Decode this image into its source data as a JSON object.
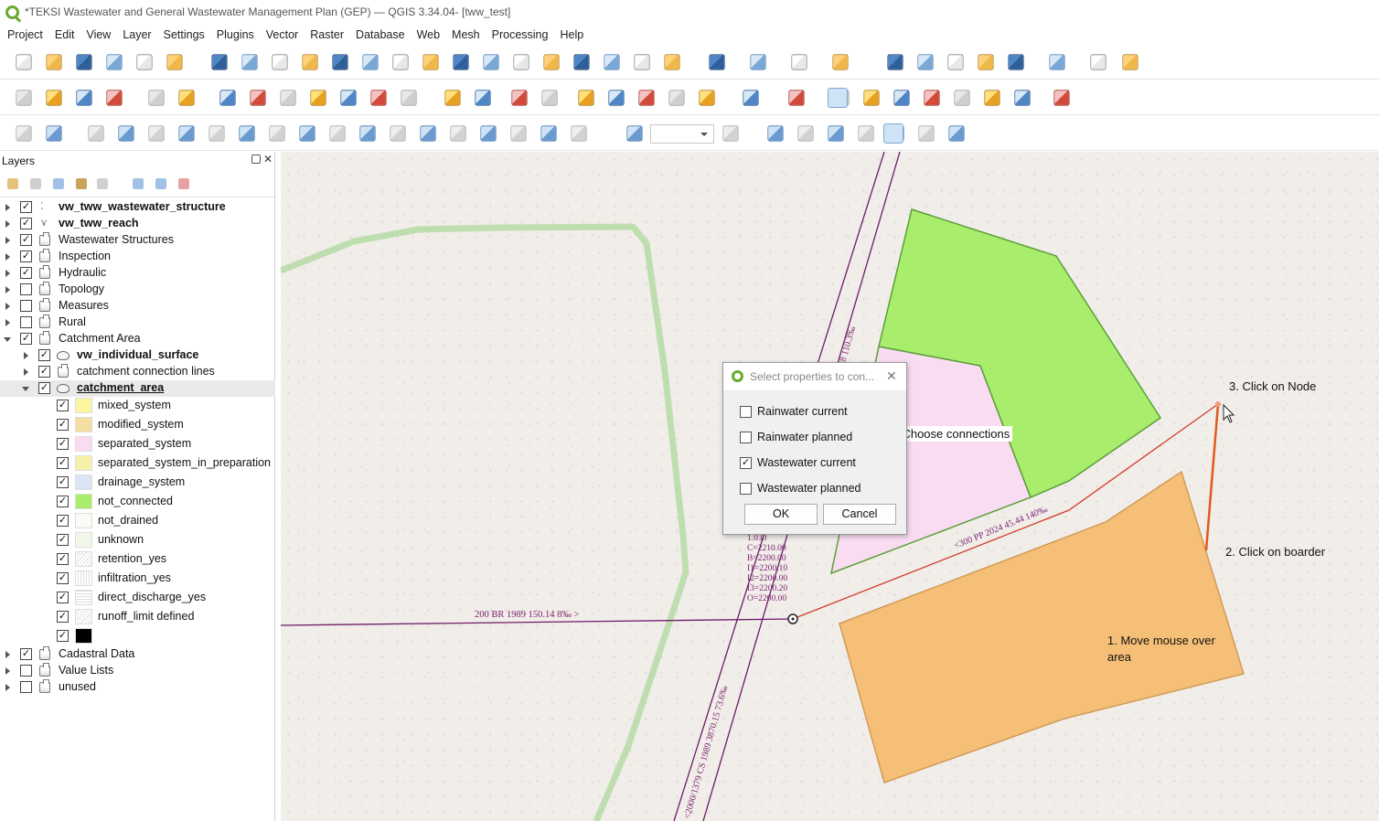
{
  "window": {
    "title": "*TEKSI Wastewater and General Wastewater Management Plan (GEP) — QGIS 3.34.04- [tww_test]"
  },
  "menu": [
    "Project",
    "Edit",
    "View",
    "Layer",
    "Settings",
    "Plugins",
    "Vector",
    "Raster",
    "Database",
    "Web",
    "Mesh",
    "Processing",
    "Help"
  ],
  "layers_panel": {
    "title": "Layers",
    "items": [
      {
        "label": "vw_tww_wastewater_structure",
        "checked": true,
        "bold": true,
        "icon": "point-layer-icon"
      },
      {
        "label": "vw_tww_reach",
        "checked": true,
        "bold": true,
        "icon": "line-layer-icon"
      },
      {
        "label": "Wastewater Structures",
        "checked": true,
        "icon": "group-icon"
      },
      {
        "label": "Inspection",
        "checked": true,
        "icon": "group-icon"
      },
      {
        "label": "Hydraulic",
        "checked": true,
        "icon": "group-icon"
      },
      {
        "label": "Topology",
        "checked": false,
        "icon": "group-icon"
      },
      {
        "label": "Measures",
        "checked": false,
        "icon": "group-icon"
      },
      {
        "label": "Rural",
        "checked": false,
        "icon": "group-icon"
      },
      {
        "label": "Catchment Area",
        "checked": true,
        "icon": "group-icon"
      },
      {
        "label": "vw_individual_surface",
        "checked": true,
        "bold": true,
        "icon": "polygon-layer-icon"
      },
      {
        "label": "catchment connection lines",
        "checked": true,
        "icon": "group-icon"
      },
      {
        "label": "catchment_area",
        "checked": true,
        "bold": true,
        "icon": "polygon-layer-icon"
      },
      {
        "label": "mixed_system",
        "checked": true,
        "color": "#fdf6a0"
      },
      {
        "label": "modified_system",
        "checked": true,
        "color": "#f6dda0"
      },
      {
        "label": "separated_system",
        "checked": true,
        "color": "#f9dcf2"
      },
      {
        "label": "separated_system_in_preparation",
        "checked": true,
        "color": "#f7f0a8"
      },
      {
        "label": "drainage_system",
        "checked": true,
        "color": "#dbe5f6"
      },
      {
        "label": "not_connected",
        "checked": true,
        "color": "#a8ee6c"
      },
      {
        "label": "not_drained",
        "checked": true,
        "color": "#fbfbf6"
      },
      {
        "label": "unknown",
        "checked": true,
        "color": "#f2f8e8"
      },
      {
        "label": "retention_yes",
        "checked": true,
        "color": "#f3f3f3"
      },
      {
        "label": "infiltration_yes",
        "checked": true,
        "color": "#f0f0f0"
      },
      {
        "label": "direct_discharge_yes",
        "checked": true,
        "color": "#f2f2f2"
      },
      {
        "label": "runoff_limit defined",
        "checked": true,
        "color": "#f5f5f5"
      },
      {
        "label": "",
        "checked": true,
        "color": "#000000"
      },
      {
        "label": "Cadastral Data",
        "checked": true,
        "icon": "group-icon"
      },
      {
        "label": "Value Lists",
        "checked": false,
        "icon": "group-icon"
      },
      {
        "label": "unused",
        "checked": false,
        "icon": "group-icon"
      }
    ]
  },
  "dialog": {
    "title": "Select properties to con...",
    "options": [
      {
        "label": "Rainwater current",
        "checked": false
      },
      {
        "label": "Rainwater planned",
        "checked": false
      },
      {
        "label": "Wastewater current",
        "checked": true
      },
      {
        "label": "Wastewater planned",
        "checked": false
      }
    ],
    "ok_label": "OK",
    "cancel_label": "Cancel"
  },
  "map": {
    "labels": {
      "reach_top": "38 110.3‰",
      "reach_bottom": "<2000/1379 CS 1989 3870.15 73.6‰",
      "reach_left": "200 BR 1989 150.14 8‰  >",
      "reach_connection": "<300 PP 2024 45.44 140‰",
      "node_info": [
        "1.030",
        "C=2210.00",
        "B=2200.00",
        "I1=2200.10",
        "I2=2200.00",
        "I3=2200.20",
        "O=2200.00"
      ]
    },
    "annotations": {
      "step1": "1. Move mouse over area",
      "step2": "2. Click on boarder",
      "step3": "3. Click on Node",
      "step4": "4. Choose connections"
    },
    "colors": {
      "not_connected": "#a8ee6c",
      "separated_system": "#f9dcf2",
      "modified_system": "#f6bf78",
      "reach": "#6e1b6b",
      "connection": "#d23a2a"
    }
  }
}
